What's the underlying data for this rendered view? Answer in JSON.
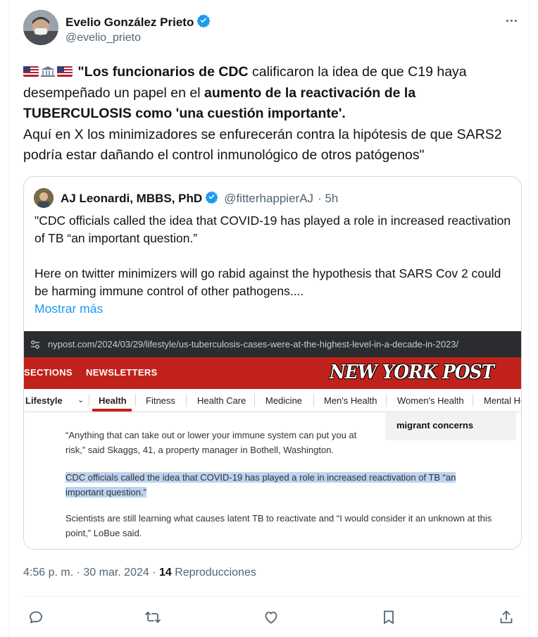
{
  "author": {
    "name": "Evelio González Prieto",
    "handle": "@evelio_prieto"
  },
  "tweet": {
    "prefix_emoji": "🇺🇸🏛️🇺🇸",
    "bold_1": "\"Los funcionarios de CDC",
    "text_1": " calificaron la idea de que C19 haya desempeñado un papel en el ",
    "bold_2": "aumento de la reactivación de la TUBERCULOSIS como 'una cuestión importante'.",
    "text_2": "Aquí en X los minimizadores se enfurecerán contra la hipótesis de que SARS2 podría estar dañando el control inmunológico de otros patógenos\""
  },
  "quote": {
    "name": "AJ Leonardi, MBBS, PhD",
    "handle": "@fitterhappierAJ",
    "time": "· 5h",
    "para_1": "\"CDC officials called the idea that COVID-19 has played a role in increased reactivation of TB “an important question.”",
    "para_2": "Here on twitter minimizers will go rabid against the hypothesis that SARS Cov 2 could be harming immune control of other pathogens....",
    "show_more": "Mostrar más"
  },
  "media": {
    "url": "nypost.com/2024/03/29/lifestyle/us-tuberculosis-cases-were-at-the-highest-level-in-a-decade-in-2023/",
    "sections": "SECTIONS",
    "newsletters": "NEWSLETTERS",
    "logo": "NEW YORK POST",
    "nav": [
      "Lifestyle",
      "Health",
      "Fitness",
      "Health Care",
      "Medicine",
      "Men's Health",
      "Women's Health",
      "Mental He"
    ],
    "sidebar_text": "migrant concerns",
    "para_1": "“Anything that can take out or lower your immune system can put you at risk,” said Skaggs, 41, a property manager in Bothell, Washington.",
    "para_2": "CDC officials called the idea that COVID-19 has played a role in increased reactivation of TB “an important question.”",
    "para_3": "Scientists are still learning what causes latent TB to reactivate and “I would consider it an unknown at this point,” LoBue said."
  },
  "meta": {
    "time": "4:56 p. m. · 30 mar. 2024 · ",
    "views_count": "14",
    "views_label": " Reproducciones"
  },
  "colors": {
    "accent": "#1d9bf0",
    "nypost_red": "#c0221b",
    "highlight": "#bcd3f0"
  }
}
